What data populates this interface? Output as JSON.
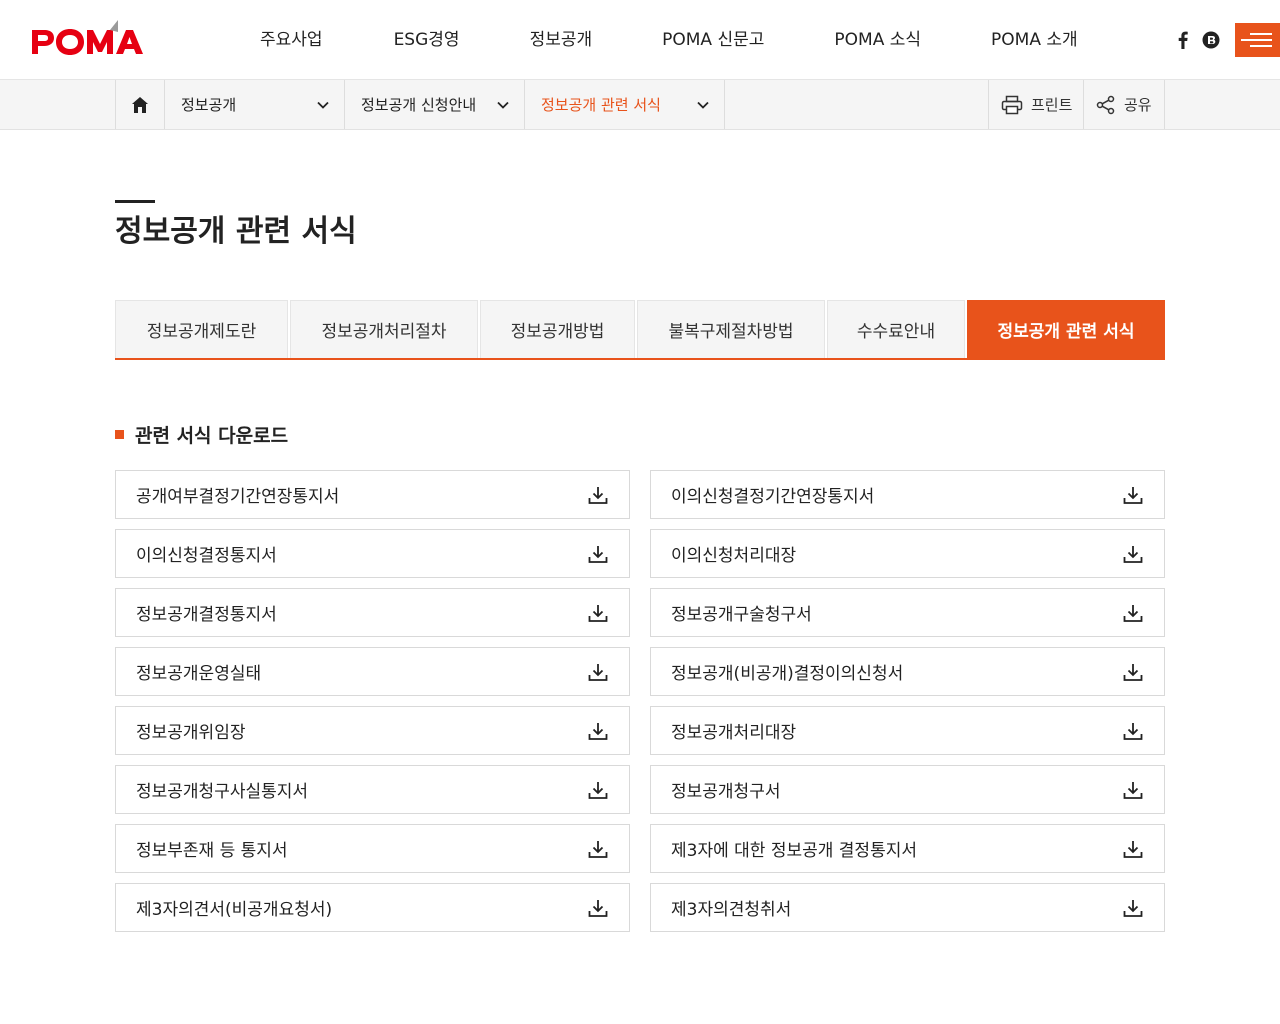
{
  "header": {
    "logo_text": "POMA",
    "nav": [
      "주요사업",
      "ESG경영",
      "정보공개",
      "POMA 신문고",
      "POMA 소식",
      "POMA 소개"
    ],
    "sns": [
      "facebook-icon",
      "blog-icon"
    ],
    "menu_icon": "hamburger-menu-icon",
    "accent_color": "#e8531b"
  },
  "location": {
    "home_icon": "home-icon",
    "depth1": "정보공개",
    "depth2": "정보공개 신청안내",
    "depth3": "정보공개 관련 서식",
    "print_label": "프린트",
    "share_label": "공유"
  },
  "page": {
    "title": "정보공개 관련 서식"
  },
  "tabs": [
    {
      "label": "정보공개제도란",
      "active": false
    },
    {
      "label": "정보공개처리절차",
      "active": false
    },
    {
      "label": "정보공개방법",
      "active": false
    },
    {
      "label": "불복구제절차방법",
      "active": false
    },
    {
      "label": "수수료안내",
      "active": false
    },
    {
      "label": "정보공개 관련 서식",
      "active": true
    }
  ],
  "section": {
    "heading": "관련 서식 다운로드"
  },
  "downloads": [
    "공개여부결정기간연장통지서",
    "이의신청결정기간연장통지서",
    "이의신청결정통지서",
    "이의신청처리대장",
    "정보공개결정통지서",
    "정보공개구술청구서",
    "정보공개운영실태",
    "정보공개(비공개)결정이의신청서",
    "정보공개위임장",
    "정보공개처리대장",
    "정보공개청구사실통지서",
    "정보공개청구서",
    "정보부존재 등 통지서",
    "제3자에 대한 정보공개 결정통지서",
    "제3자의견서(비공개요청서)",
    "제3자의견청취서"
  ]
}
